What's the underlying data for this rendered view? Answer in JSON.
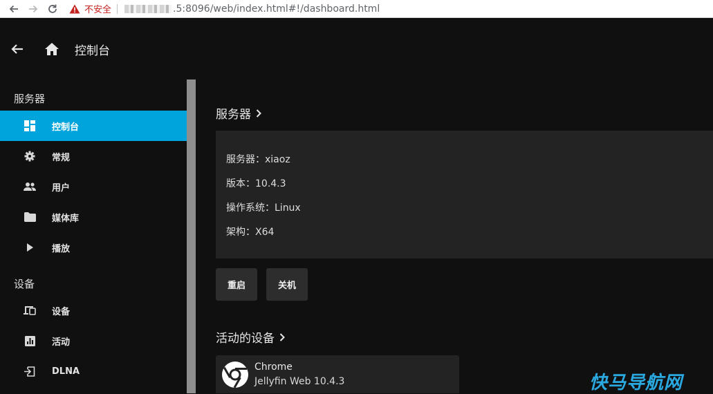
{
  "browser": {
    "security_label": "不安全",
    "url": ".5:8096/web/index.html#!/dashboard.html"
  },
  "header": {
    "title": "控制台"
  },
  "sidebar": {
    "server_heading": "服务器",
    "server_items": [
      {
        "label": "控制台",
        "icon": "dashboard-icon",
        "active": true
      },
      {
        "label": "常规",
        "icon": "gear-icon"
      },
      {
        "label": "用户",
        "icon": "people-icon"
      },
      {
        "label": "媒体库",
        "icon": "folder-icon"
      },
      {
        "label": "播放",
        "icon": "play-icon"
      }
    ],
    "devices_heading": "设备",
    "device_items": [
      {
        "label": "设备",
        "icon": "devices-icon"
      },
      {
        "label": "活动",
        "icon": "activity-icon"
      },
      {
        "label": "DLNA",
        "icon": "dlna-input-icon"
      }
    ]
  },
  "main": {
    "server_section_title": "服务器",
    "server_info": {
      "name": "服务器：xiaoz",
      "version": "版本：10.4.3",
      "os": "操作系统：Linux",
      "arch": "架构：X64"
    },
    "restart_label": "重启",
    "shutdown_label": "关机",
    "active_devices_title": "活动的设备",
    "device": {
      "name": "Chrome",
      "app": "Jellyfin Web 10.4.3"
    }
  },
  "watermark": "快马导航网",
  "colors": {
    "accent": "#00a4dc",
    "background": "#101010",
    "card": "#232323"
  }
}
